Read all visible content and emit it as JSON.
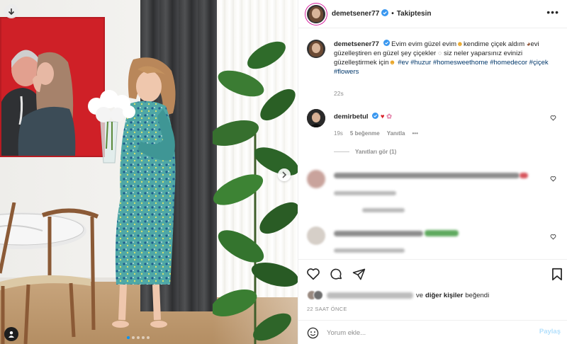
{
  "post": {
    "author": "demetsener77",
    "separator": "•",
    "follow_label": "Takiptesin",
    "more_label": "•••",
    "caption": {
      "username": "demetsener77",
      "text_1": " Evim evim güzel evim",
      "text_2": "kendime çiçek aldım",
      "text_3": "evi güzelleştiren en güzel şey çiçekler",
      "text_4": " siz neler yaparsınız evinizi güzelleştirmek için",
      "hashtags": [
        "#ev",
        "#huzur",
        "#homesweethome",
        "#homedecor",
        "#çiçek",
        "#flowers"
      ],
      "time": "22s"
    },
    "comment": {
      "username": "demirbetul",
      "time": "19s",
      "likes": "5 beğenme",
      "reply_label": "Yanıtla",
      "more_label": "•••",
      "view_replies": "Yanıtları gör (1)"
    },
    "likes_text": {
      "connector": "ve",
      "others": "diğer kişiler",
      "suffix": "beğendi"
    },
    "timestamp": "22 SAAT ÖNCE",
    "add_comment": {
      "placeholder": "Yorum ekle...",
      "post_label": "Paylaş"
    }
  },
  "icons": {
    "nav_down": "arrow-down-icon",
    "nav_next": "chevron-right-icon",
    "user_tag": "user-tag-icon",
    "verified": "verified-badge-icon",
    "like": "heart-icon",
    "comment": "comment-icon",
    "share": "paper-plane-icon",
    "save": "bookmark-icon",
    "emoji": "smiley-icon"
  },
  "colors": {
    "verified": "#3897f0",
    "link": "#00376b",
    "muted": "#8e8e8e",
    "post_button": "#b2dffc",
    "carousel_active": "#0095f6"
  }
}
